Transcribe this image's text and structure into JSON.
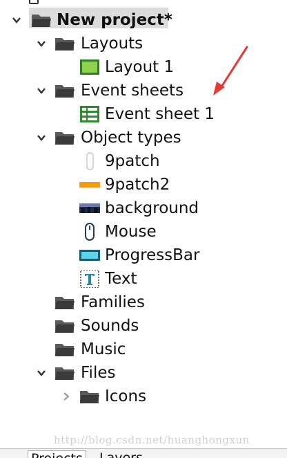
{
  "project": {
    "title": "New project*",
    "groups": {
      "layouts": {
        "label": "Layouts",
        "items": [
          {
            "label": "Layout 1"
          }
        ]
      },
      "event_sheets": {
        "label": "Event sheets",
        "items": [
          {
            "label": "Event sheet 1"
          }
        ]
      },
      "object_types": {
        "label": "Object types",
        "items": [
          {
            "label": "9patch"
          },
          {
            "label": "9patch2"
          },
          {
            "label": "background"
          },
          {
            "label": "Mouse"
          },
          {
            "label": "ProgressBar"
          },
          {
            "label": "Text"
          }
        ]
      },
      "families": {
        "label": "Families"
      },
      "sounds": {
        "label": "Sounds"
      },
      "music": {
        "label": "Music"
      },
      "files": {
        "label": "Files",
        "items": [
          {
            "label": "Icons"
          }
        ]
      }
    }
  },
  "watermark": "http://blog.csdn.net/huanghongxun",
  "tabs": [
    {
      "label": "Projects"
    },
    {
      "label": "Layers"
    }
  ],
  "colors": {
    "arrow": "#e53935",
    "folder": "#4a4a4a",
    "layout_icon": "#6dbb2e",
    "sheet_icon": "#3a9a3a",
    "accent_bar": "#f39c12",
    "progress_icon": "#1a8fb0"
  }
}
